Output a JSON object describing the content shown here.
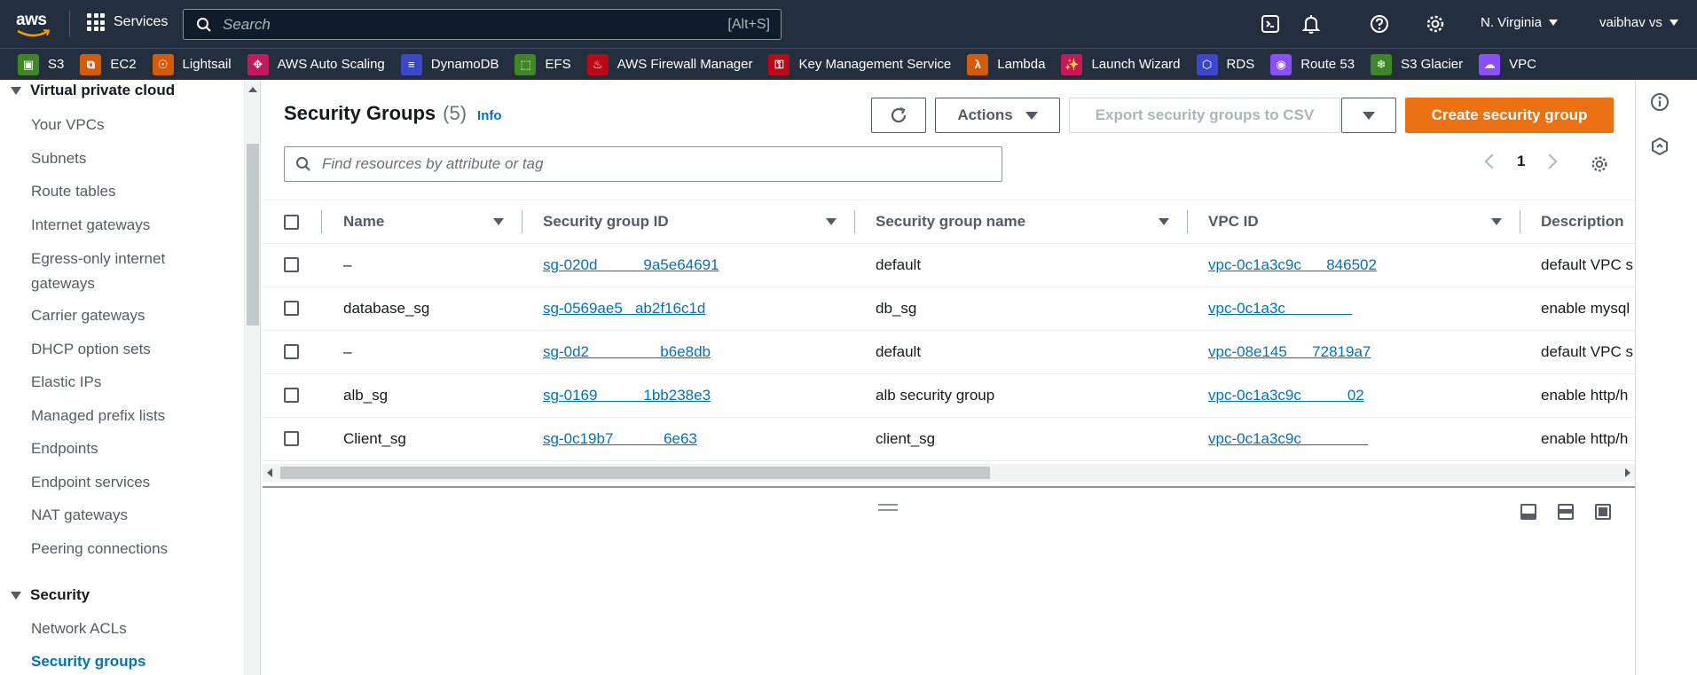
{
  "topnav": {
    "services_label": "Services",
    "search_placeholder": "Search",
    "search_shortcut": "[Alt+S]",
    "region": "N. Virginia",
    "user": "vaibhav vs"
  },
  "favorites": [
    {
      "label": "S3",
      "icon": "s3-icon",
      "color": "#3f8624"
    },
    {
      "label": "EC2",
      "icon": "ec2-icon",
      "color": "#d45b07"
    },
    {
      "label": "Lightsail",
      "icon": "lightsail-icon",
      "color": "#d45b07"
    },
    {
      "label": "AWS Auto Scaling",
      "icon": "autoscaling-icon",
      "color": "#c7175b"
    },
    {
      "label": "DynamoDB",
      "icon": "dynamodb-icon",
      "color": "#3b48cc"
    },
    {
      "label": "EFS",
      "icon": "efs-icon",
      "color": "#3f8624"
    },
    {
      "label": "AWS Firewall Manager",
      "icon": "firewall-icon",
      "color": "#bf0816"
    },
    {
      "label": "Key Management Service",
      "icon": "kms-icon",
      "color": "#bf0816"
    },
    {
      "label": "Lambda",
      "icon": "lambda-icon",
      "color": "#d45b07"
    },
    {
      "label": "Launch Wizard",
      "icon": "launch-wizard-icon",
      "color": "#c7175b"
    },
    {
      "label": "RDS",
      "icon": "rds-icon",
      "color": "#3b48cc"
    },
    {
      "label": "Route 53",
      "icon": "route53-icon",
      "color": "#8c4fff"
    },
    {
      "label": "S3 Glacier",
      "icon": "glacier-icon",
      "color": "#3f8624"
    },
    {
      "label": "VPC",
      "icon": "vpc-icon",
      "color": "#8c4fff"
    }
  ],
  "sidebar": {
    "section1": "Virtual private cloud",
    "items1": [
      "Your VPCs",
      "Subnets",
      "Route tables",
      "Internet gateways",
      "Egress-only internet",
      "gateways",
      "Carrier gateways",
      "DHCP option sets",
      "Elastic IPs",
      "Managed prefix lists",
      "Endpoints",
      "Endpoint services",
      "NAT gateways",
      "Peering connections"
    ],
    "section2": "Security",
    "items2": [
      "Network ACLs",
      "Security groups"
    ]
  },
  "main": {
    "title": "Security Groups",
    "count": "(5)",
    "info": "Info",
    "actions_label": "Actions",
    "export_label": "Export security groups to CSV",
    "create_label": "Create security group",
    "filter_placeholder": "Find resources by attribute or tag",
    "page": "1"
  },
  "table": {
    "headers": [
      "Name",
      "Security group ID",
      "Security group name",
      "VPC ID",
      "Description"
    ],
    "rows": [
      {
        "name": "–",
        "sgid": "sg-020d           9a5e64691",
        "sgname": "default",
        "vpc": "vpc-0c1a3c9c      846502",
        "desc": "default VPC s"
      },
      {
        "name": "database_sg",
        "sgid": "sg-0569ae5   ab2f16c1d",
        "sgname": "db_sg",
        "vpc": "vpc-0c1a3c                ",
        "desc": "enable mysql"
      },
      {
        "name": "–",
        "sgid": "sg-0d2                 b6e8db",
        "sgname": "default",
        "vpc": "vpc-08e145      72819a7",
        "desc": "default VPC s"
      },
      {
        "name": "alb_sg",
        "sgid": "sg-0169           1bb238e3",
        "sgname": "alb security group",
        "vpc": "vpc-0c1a3c9c           02",
        "desc": "enable http/h"
      },
      {
        "name": "Client_sg",
        "sgid": "sg-0c19b7            6e63",
        "sgname": "client_sg",
        "vpc": "vpc-0c1a3c9c                ",
        "desc": "enable http/h"
      }
    ]
  },
  "colors": {
    "nav_bg": "#232f3e",
    "primary": "#ec7211",
    "link": "#0073bb"
  }
}
